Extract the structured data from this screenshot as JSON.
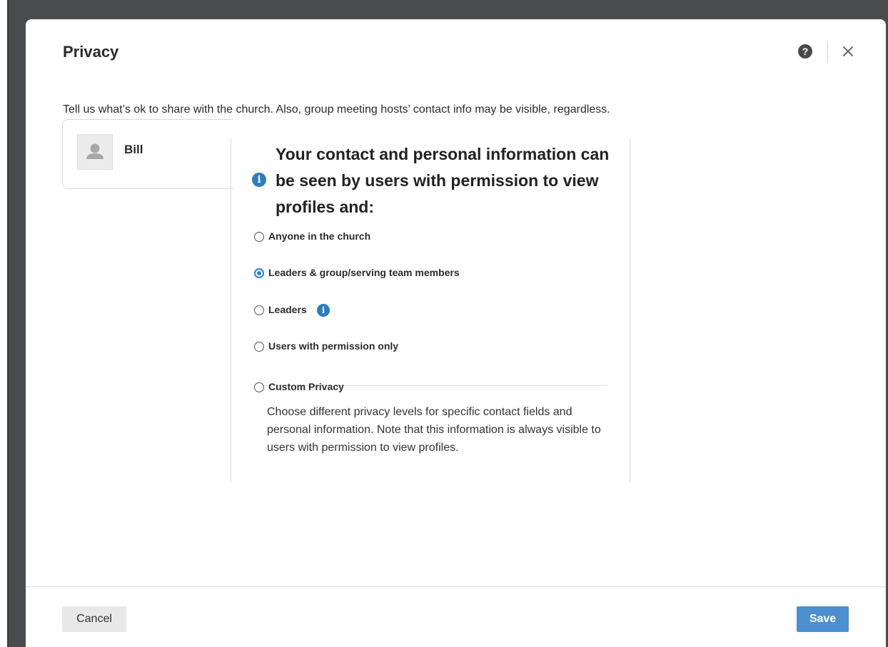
{
  "modal": {
    "title": "Privacy",
    "help_icon": "question-circle-icon",
    "close_icon": "close-icon",
    "intro": "Tell us what’s ok to share with the church. Also, group meeting hosts’ contact info may be visible, regardless."
  },
  "person": {
    "name": "Bill",
    "avatar_icon": "person-placeholder-icon"
  },
  "panel": {
    "heading": "Your contact and personal information can be seen by users with permission to view profiles and:",
    "options": [
      {
        "label": "Anyone in the church",
        "selected": false
      },
      {
        "label": "Leaders & group/serving team members",
        "selected": true
      },
      {
        "label": "Leaders",
        "selected": false,
        "info_icon": "info-icon"
      },
      {
        "label": "Users with permission only",
        "selected": false
      },
      {
        "label": "Custom Privacy",
        "selected": false
      }
    ],
    "custom_description": "Choose different privacy levels for specific contact fields and personal information. Note that this information is always visible to users with permission to view profiles."
  },
  "footer": {
    "cancel_label": "Cancel",
    "save_label": "Save"
  },
  "colors": {
    "accent": "#2680eb",
    "info": "#2a7dc0",
    "save_button": "#4b8fd0",
    "backdrop": "#4a4b4c"
  }
}
